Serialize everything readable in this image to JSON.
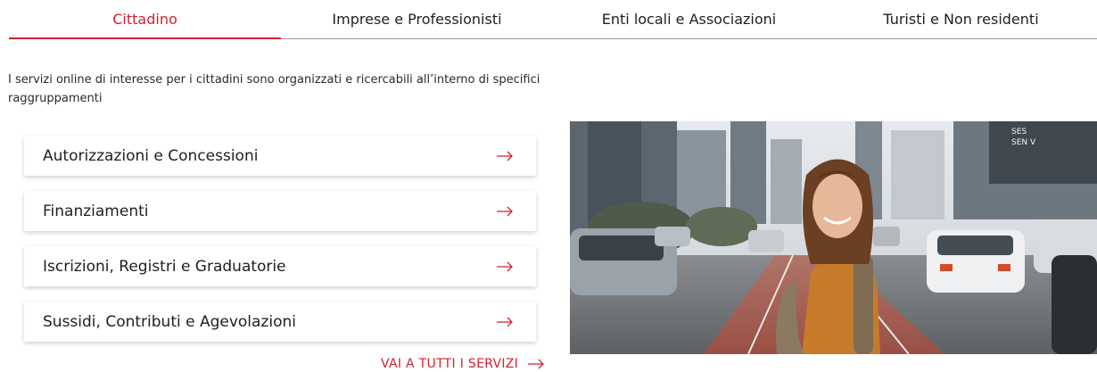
{
  "tabs": [
    {
      "label": "Cittadino",
      "active": true
    },
    {
      "label": "Imprese e Professionisti",
      "active": false
    },
    {
      "label": "Enti locali e Associazioni",
      "active": false
    },
    {
      "label": "Turisti e Non residenti",
      "active": false
    }
  ],
  "intro": "I servizi online di interesse per i cittadini sono organizzati e ricercabili all’interno di specifici raggruppamenti",
  "services": [
    {
      "label": "Autorizzazioni e Concessioni",
      "icon": "arrow-right-icon"
    },
    {
      "label": "Finanziamenti",
      "icon": "arrow-right-icon"
    },
    {
      "label": "Iscrizioni, Registri e Graduatorie",
      "icon": "arrow-right-icon"
    },
    {
      "label": "Sussidi, Contributi e Agevolazioni",
      "icon": "arrow-right-icon"
    }
  ],
  "all_services": {
    "label": "VAI A TUTTI I SERVIZI",
    "icon": "arrow-right-icon"
  },
  "hero_image": {
    "sign_text": "SES\nSEN V"
  },
  "colors": {
    "accent": "#d32030",
    "text": "#1f1f1f",
    "divider": "#9a9a9a"
  }
}
